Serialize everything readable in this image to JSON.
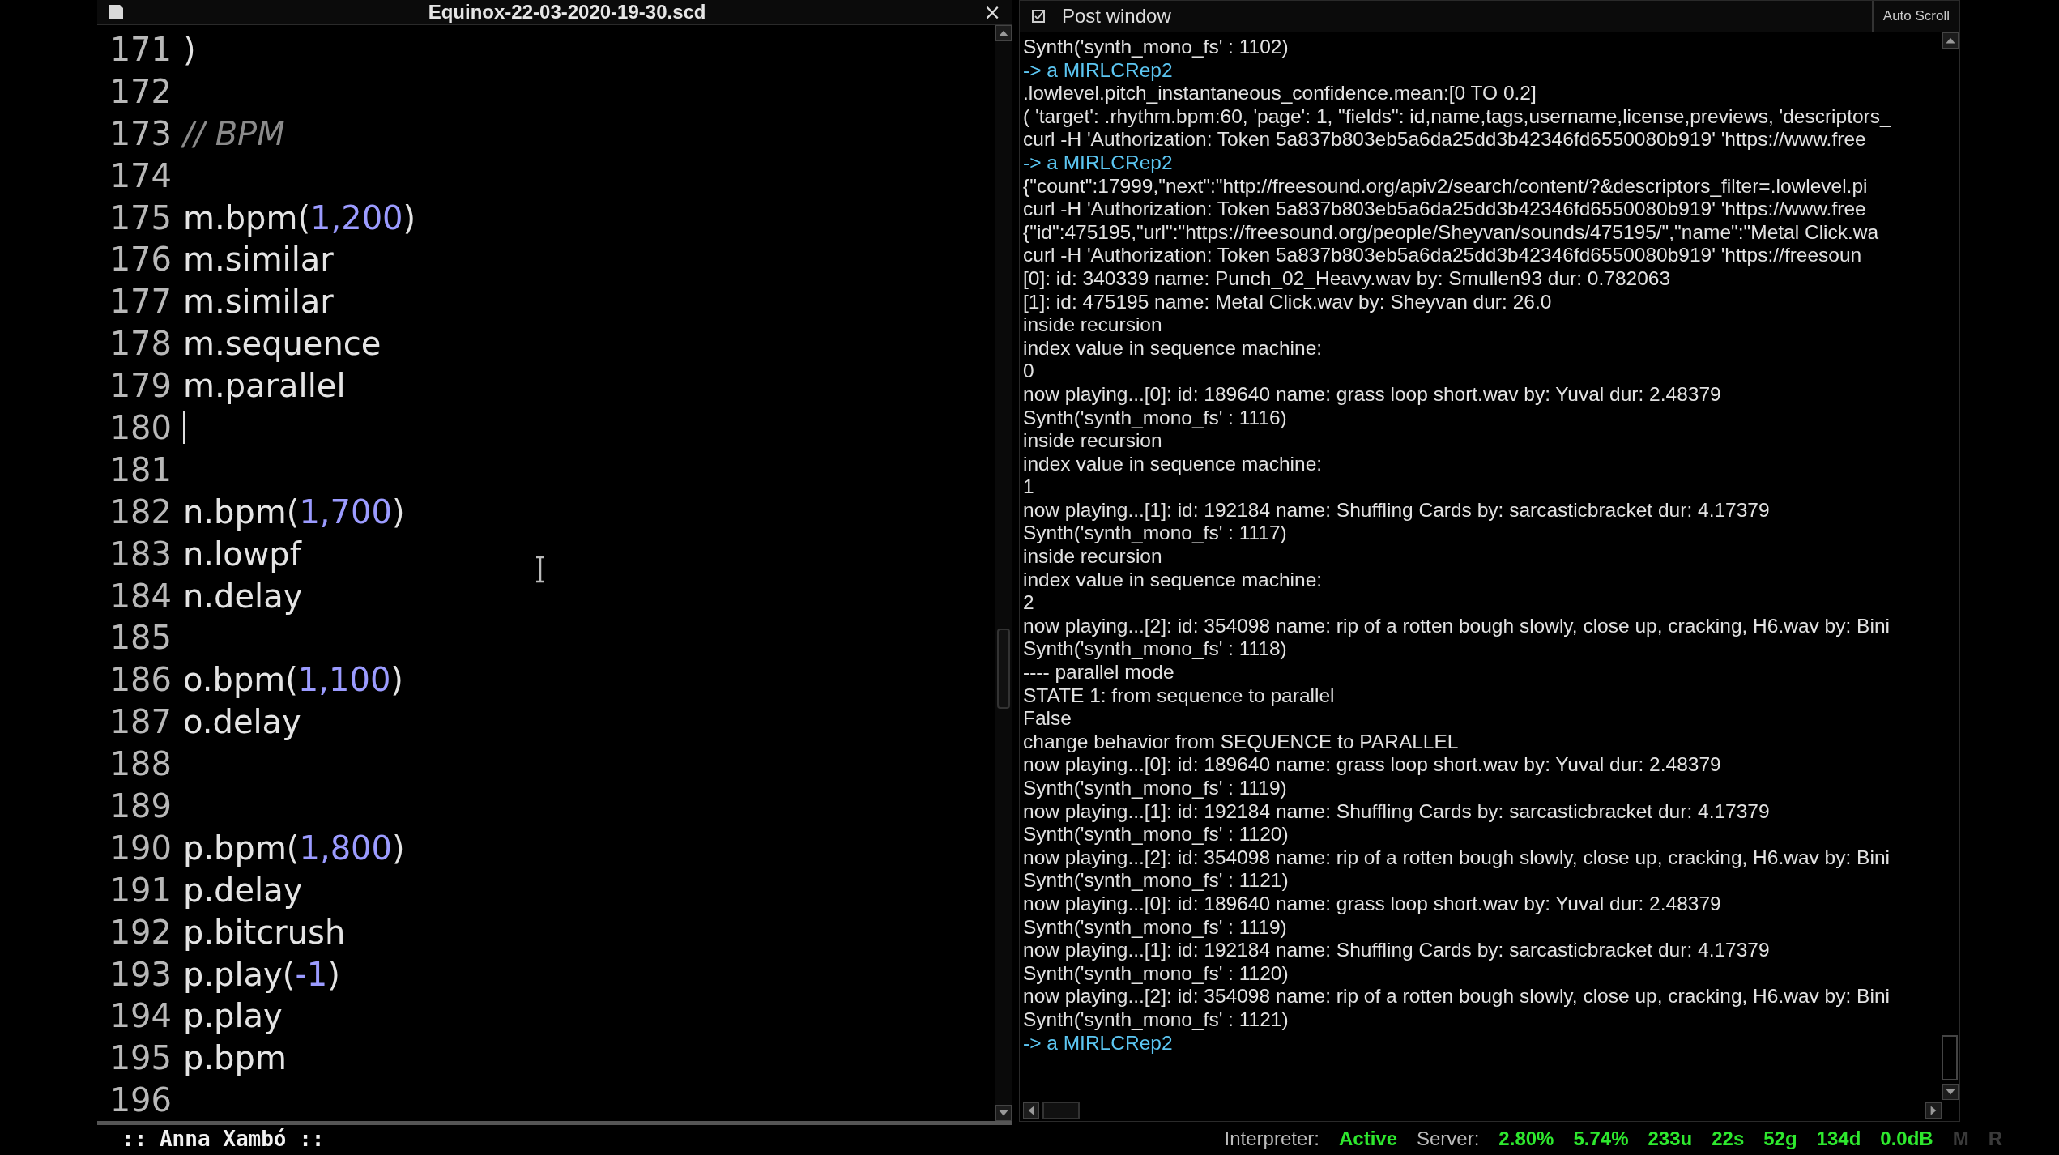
{
  "editor": {
    "title": "Equinox-22-03-2020-19-30.scd",
    "close": "×",
    "lines": [
      {
        "number": "171",
        "segments": [
          {
            "text": ")",
            "kind": "code"
          }
        ]
      },
      {
        "number": "172"
      },
      {
        "number": "173",
        "segments": [
          {
            "text": "// BPM",
            "kind": "comment"
          }
        ]
      },
      {
        "number": "174"
      },
      {
        "number": "175",
        "segments": [
          {
            "text": "m.bpm(",
            "kind": "code"
          },
          {
            "text": "1,200",
            "kind": "number"
          },
          {
            "text": ")",
            "kind": "code"
          }
        ]
      },
      {
        "number": "176",
        "segments": [
          {
            "text": "m.similar",
            "kind": "code"
          }
        ]
      },
      {
        "number": "177",
        "segments": [
          {
            "text": "m.similar",
            "kind": "code"
          }
        ]
      },
      {
        "number": "178",
        "segments": [
          {
            "text": "m.sequence",
            "kind": "code"
          }
        ]
      },
      {
        "number": "179",
        "segments": [
          {
            "text": "m.parallel",
            "kind": "code"
          }
        ]
      },
      {
        "number": "180",
        "cursor": true
      },
      {
        "number": "181"
      },
      {
        "number": "182",
        "segments": [
          {
            "text": "n.bpm(",
            "kind": "code"
          },
          {
            "text": "1,700",
            "kind": "number"
          },
          {
            "text": ")",
            "kind": "code"
          }
        ]
      },
      {
        "number": "183",
        "segments": [
          {
            "text": "n.lowpf",
            "kind": "code"
          }
        ]
      },
      {
        "number": "184",
        "segments": [
          {
            "text": "n.delay",
            "kind": "code"
          }
        ]
      },
      {
        "number": "185"
      },
      {
        "number": "186",
        "segments": [
          {
            "text": "o.bpm(",
            "kind": "code"
          },
          {
            "text": "1,100",
            "kind": "number"
          },
          {
            "text": ")",
            "kind": "code"
          }
        ]
      },
      {
        "number": "187",
        "segments": [
          {
            "text": "o.delay",
            "kind": "code"
          }
        ]
      },
      {
        "number": "188"
      },
      {
        "number": "189"
      },
      {
        "number": "190",
        "segments": [
          {
            "text": "p.bpm(",
            "kind": "code"
          },
          {
            "text": "1,800",
            "kind": "number"
          },
          {
            "text": ")",
            "kind": "code"
          }
        ]
      },
      {
        "number": "191",
        "segments": [
          {
            "text": "p.delay",
            "kind": "code"
          }
        ]
      },
      {
        "number": "192",
        "segments": [
          {
            "text": "p.bitcrush",
            "kind": "code"
          }
        ]
      },
      {
        "number": "193",
        "segments": [
          {
            "text": "p.play(",
            "kind": "code"
          },
          {
            "text": "-1",
            "kind": "number"
          },
          {
            "text": ")",
            "kind": "code"
          }
        ]
      },
      {
        "number": "194",
        "segments": [
          {
            "text": "p.play",
            "kind": "code"
          }
        ]
      },
      {
        "number": "195",
        "segments": [
          {
            "text": "p.bpm",
            "kind": "code"
          }
        ]
      },
      {
        "number": "196"
      }
    ]
  },
  "post_window": {
    "title": "Post window",
    "auto_scroll": "Auto Scroll",
    "lines": [
      {
        "text": "Synth('synth_mono_fs' : 1102)",
        "kind": "output"
      },
      {
        "text": "-> a MIRLCRep2",
        "kind": "return"
      },
      {
        "text": ".lowlevel.pitch_instantaneous_confidence.mean:[0 TO 0.2]",
        "kind": "output"
      },
      {
        "text": "( 'target': .rhythm.bpm:60, 'page': 1, \"fields\": id,name,tags,username,license,previews, 'descriptors_",
        "kind": "output"
      },
      {
        "text": "curl -H 'Authorization: Token 5a837b803eb5a6da25dd3b42346fd6550080b919' 'https://www.free",
        "kind": "output"
      },
      {
        "text": "-> a MIRLCRep2",
        "kind": "return"
      },
      {
        "text": "{\"count\":17999,\"next\":\"http://freesound.org/apiv2/search/content/?&descriptors_filter=.lowlevel.pi",
        "kind": "output"
      },
      {
        "text": "curl -H 'Authorization: Token 5a837b803eb5a6da25dd3b42346fd6550080b919' 'https://www.free",
        "kind": "output"
      },
      {
        "text": "{\"id\":475195,\"url\":\"https://freesound.org/people/Sheyvan/sounds/475195/\",\"name\":\"Metal Click.wa",
        "kind": "output"
      },
      {
        "text": "curl -H 'Authorization: Token 5a837b803eb5a6da25dd3b42346fd6550080b919' 'https://freesoun",
        "kind": "output"
      },
      {
        "text": "[0]: id: 340339 name: Punch_02_Heavy.wav by: Smullen93 dur: 0.782063",
        "kind": "output"
      },
      {
        "text": "[1]: id: 475195 name: Metal Click.wav by: Sheyvan dur: 26.0",
        "kind": "output"
      },
      {
        "text": "inside recursion",
        "kind": "output"
      },
      {
        "text": "index value in sequence machine:",
        "kind": "output"
      },
      {
        "text": "0",
        "kind": "output"
      },
      {
        "text": "now playing...[0]: id: 189640 name: grass loop short.wav by: Yuval dur: 2.48379",
        "kind": "output"
      },
      {
        "text": "Synth('synth_mono_fs' : 1116)",
        "kind": "output"
      },
      {
        "text": "inside recursion",
        "kind": "output"
      },
      {
        "text": "index value in sequence machine:",
        "kind": "output"
      },
      {
        "text": "1",
        "kind": "output"
      },
      {
        "text": "now playing...[1]: id: 192184 name: Shuffling Cards by: sarcasticbracket dur: 4.17379",
        "kind": "output"
      },
      {
        "text": "Synth('synth_mono_fs' : 1117)",
        "kind": "output"
      },
      {
        "text": "inside recursion",
        "kind": "output"
      },
      {
        "text": "index value in sequence machine:",
        "kind": "output"
      },
      {
        "text": "2",
        "kind": "output"
      },
      {
        "text": "now playing...[2]: id: 354098 name: rip of a rotten bough slowly, close up, cracking, H6.wav by: Bini",
        "kind": "output"
      },
      {
        "text": "Synth('synth_mono_fs' : 1118)",
        "kind": "output"
      },
      {
        "text": "---- parallel mode",
        "kind": "output"
      },
      {
        "text": "STATE 1: from sequence to parallel",
        "kind": "output"
      },
      {
        "text": "False",
        "kind": "output"
      },
      {
        "text": "change behavior from SEQUENCE to PARALLEL",
        "kind": "output"
      },
      {
        "text": "now playing...[0]: id: 189640 name: grass loop short.wav by: Yuval dur: 2.48379",
        "kind": "output"
      },
      {
        "text": "Synth('synth_mono_fs' : 1119)",
        "kind": "output"
      },
      {
        "text": "now playing...[1]: id: 192184 name: Shuffling Cards by: sarcasticbracket dur: 4.17379",
        "kind": "output"
      },
      {
        "text": "Synth('synth_mono_fs' : 1120)",
        "kind": "output"
      },
      {
        "text": "now playing...[2]: id: 354098 name: rip of a rotten bough slowly, close up, cracking, H6.wav by: Bini",
        "kind": "output"
      },
      {
        "text": "Synth('synth_mono_fs' : 1121)",
        "kind": "output"
      },
      {
        "text": "now playing...[0]: id: 189640 name: grass loop short.wav by: Yuval dur: 2.48379",
        "kind": "output"
      },
      {
        "text": "Synth('synth_mono_fs' : 1119)",
        "kind": "output"
      },
      {
        "text": "now playing...[1]: id: 192184 name: Shuffling Cards by: sarcasticbracket dur: 4.17379",
        "kind": "output"
      },
      {
        "text": "Synth('synth_mono_fs' : 1120)",
        "kind": "output"
      },
      {
        "text": "now playing...[2]: id: 354098 name: rip of a rotten bough slowly, close up, cracking, H6.wav by: Bini",
        "kind": "output"
      },
      {
        "text": "Synth('synth_mono_fs' : 1121)",
        "kind": "output"
      },
      {
        "text": "-> a MIRLCRep2",
        "kind": "return"
      }
    ]
  },
  "footer": {
    "author": ":: Anna Xambó ::"
  },
  "status_bar": [
    {
      "text": "Interpreter:",
      "kind": "label"
    },
    {
      "text": "Active",
      "kind": "value"
    },
    {
      "text": "Server:",
      "kind": "label"
    },
    {
      "text": "2.80%",
      "kind": "value"
    },
    {
      "text": "5.74%",
      "kind": "value"
    },
    {
      "text": "233u",
      "kind": "value"
    },
    {
      "text": "22s",
      "kind": "value"
    },
    {
      "text": "52g",
      "kind": "value"
    },
    {
      "text": "134d",
      "kind": "value"
    },
    {
      "text": "0.0dB",
      "kind": "value"
    },
    {
      "text": "M",
      "kind": "dim"
    },
    {
      "text": "R",
      "kind": "dim"
    }
  ]
}
